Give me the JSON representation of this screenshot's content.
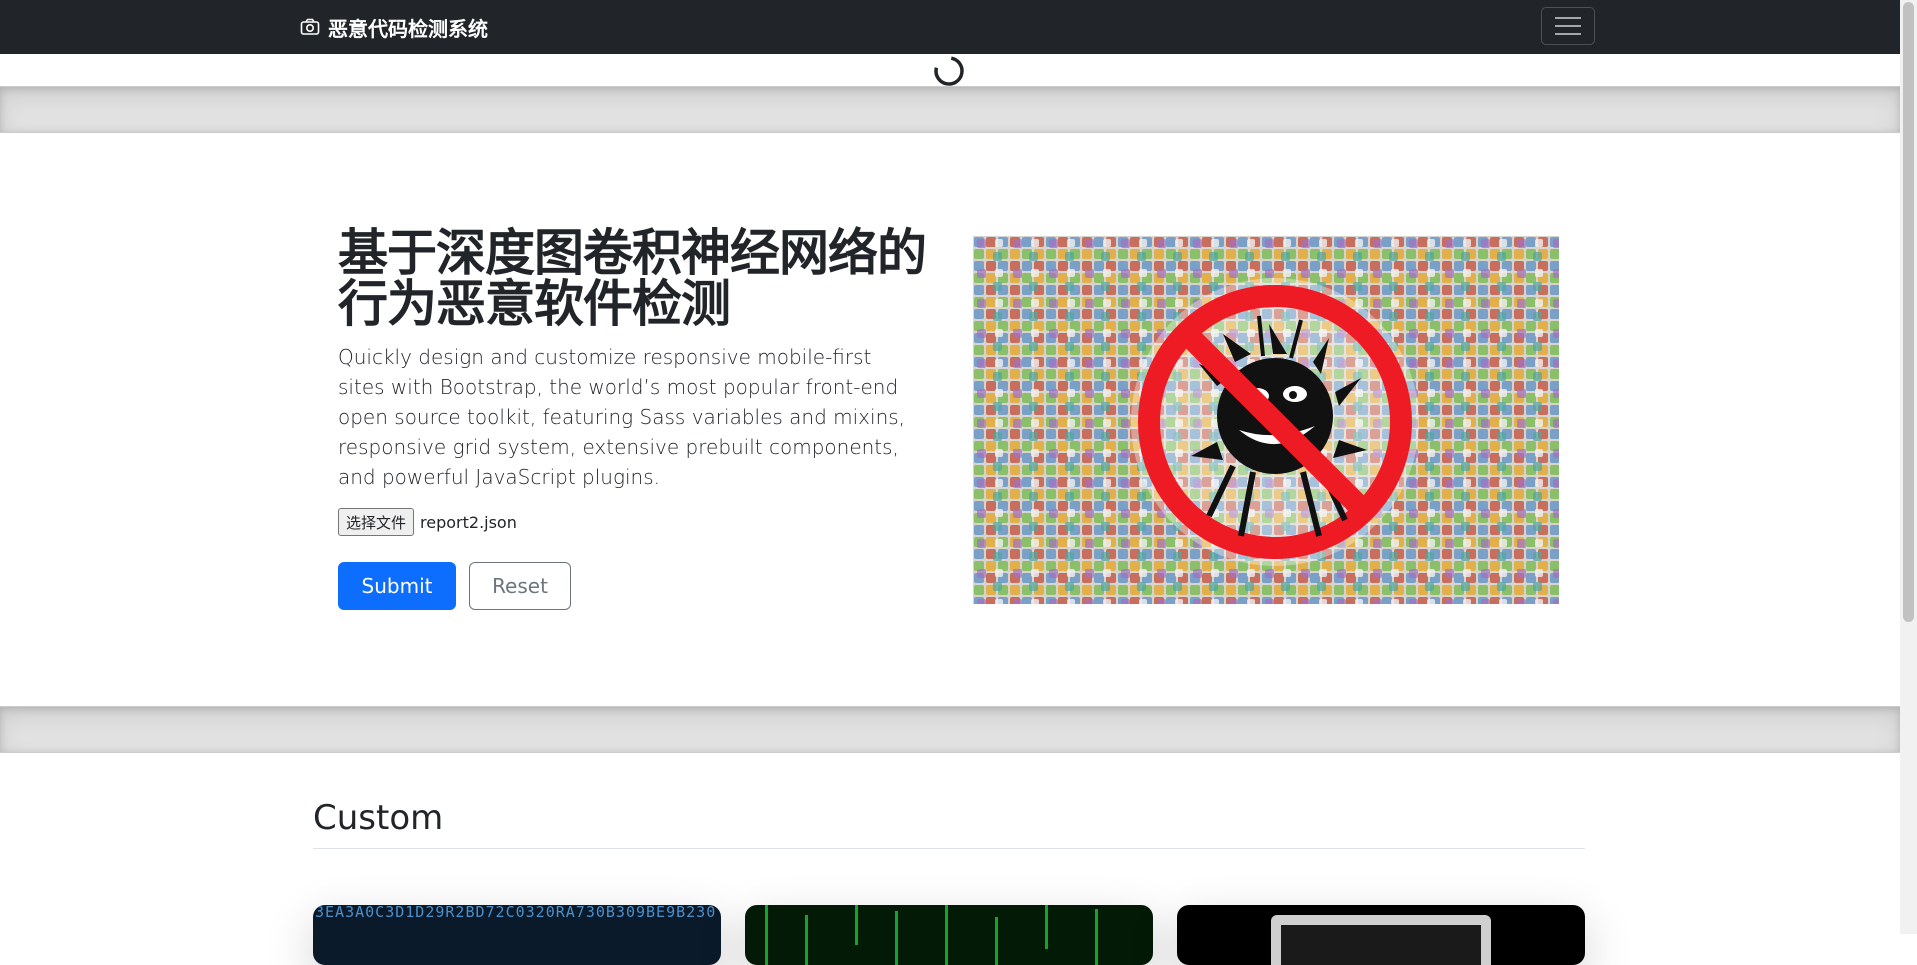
{
  "navbar": {
    "brand_icon": "camera-icon",
    "brand_text": "恶意代码检测系统",
    "toggler_icon": "hamburger-menu-icon"
  },
  "hero": {
    "title": "基于深度图卷积神经网络的行为恶意软件检测",
    "lead": "Quickly design and customize responsive mobile-first sites with Bootstrap, the world’s most popular front-end open source toolkit, featuring Sass variables and mixins, responsive grid system, extensive prebuilt components, and powerful JavaScript plugins.",
    "file_button_label": "选择文件",
    "file_name": "report2.json",
    "submit_label": "Submit",
    "reset_label": "Reset",
    "image_description": "no-malware-bug-icon"
  },
  "custom_section": {
    "title": "Custom",
    "card1_code": "3EA3A0C3D1D29R2BD72C0320RA730B309BE9B230"
  },
  "colors": {
    "navbar_bg": "#212529",
    "primary": "#0d6efd",
    "secondary": "#6c757d",
    "divider_bg": "#e2e2e2"
  }
}
